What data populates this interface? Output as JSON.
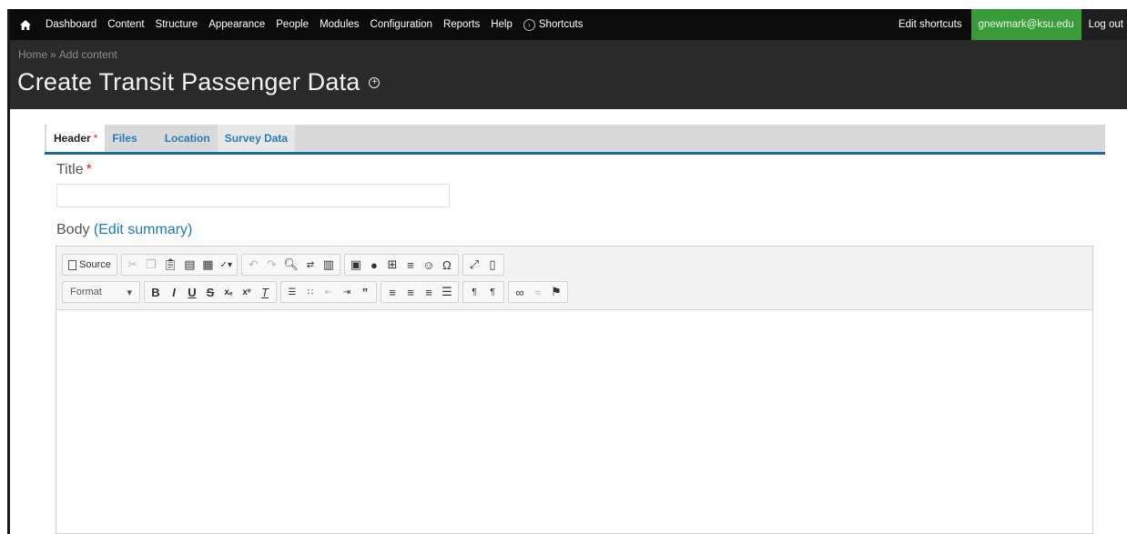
{
  "toolbar": {
    "menu": [
      "Dashboard",
      "Content",
      "Structure",
      "Appearance",
      "People",
      "Modules",
      "Configuration",
      "Reports",
      "Help"
    ],
    "shortcuts_label": "Shortcuts",
    "edit_shortcuts": "Edit shortcuts",
    "user": "gnewmark@ksu.edu",
    "logout": "Log out"
  },
  "breadcrumb": {
    "home": "Home",
    "separator": "»",
    "current": "Add content"
  },
  "page": {
    "title": "Create Transit Passenger Data"
  },
  "tabs": [
    {
      "label": "Header",
      "required": "*"
    },
    {
      "label": "Files"
    },
    {
      "label": "Location"
    },
    {
      "label": "Survey Data"
    }
  ],
  "form": {
    "title_label": "Title",
    "required_mark": "*",
    "title_value": "",
    "body_label": "Body",
    "edit_summary_link": "(Edit summary)"
  },
  "editor": {
    "source_label": "Source",
    "format_label": "Format",
    "row1_icons": [
      "source-icon",
      "cut-icon",
      "copy-icon",
      "paste-icon",
      "paste-text-icon",
      "paste-word-icon",
      "spellcheck-icon",
      "undo-icon",
      "redo-icon",
      "find-icon",
      "replace-icon",
      "select-all-icon",
      "image-icon",
      "flash-icon",
      "table-icon",
      "horizontal-rule-icon",
      "smiley-icon",
      "special-char-icon",
      "maximize-icon",
      "show-blocks-icon"
    ],
    "row2_icons": [
      "format-dropdown",
      "bold-icon",
      "italic-icon",
      "underline-icon",
      "strike-icon",
      "subscript-icon",
      "superscript-icon",
      "remove-format-icon",
      "numbered-list-icon",
      "bulleted-list-icon",
      "outdent-icon",
      "indent-icon",
      "blockquote-icon",
      "align-left-icon",
      "align-center-icon",
      "align-right-icon",
      "justify-icon",
      "ltr-icon",
      "rtl-icon",
      "link-icon",
      "unlink-icon",
      "anchor-icon"
    ]
  },
  "colors": {
    "toolbar_bg": "#0b0b0b",
    "header_bg": "#2a2a2a",
    "user_badge": "#3a9b3a",
    "tab_accent": "#1b6aa0",
    "link": "#1b7ac0",
    "required": "#dd2222"
  }
}
